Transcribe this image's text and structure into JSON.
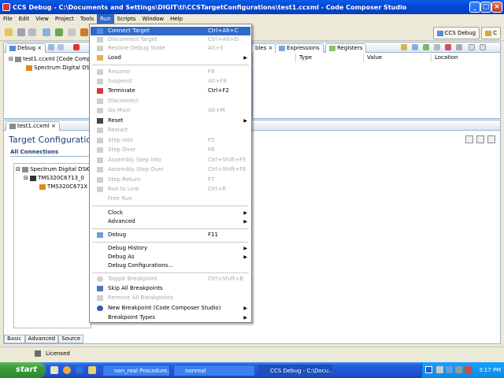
{
  "window": {
    "title": "CCS Debug - C:\\Documents and Settings\\DIGIT\\ti\\CCSTargetConfigurations\\test1.ccxml - Code Composer Studio"
  },
  "menubar": [
    "File",
    "Edit",
    "View",
    "Project",
    "Tools",
    "Run",
    "Scripts",
    "Window",
    "Help"
  ],
  "perspectives": {
    "ccs_debug": "CCS Debug",
    "c_label": "C"
  },
  "debug_view": {
    "tab": "Debug",
    "items": [
      "test1.ccxml [Code Compos",
      "Spectrum Digital DSK-E"
    ]
  },
  "variables_view": {
    "tabs": [
      "bles",
      "Expressions",
      "Registers"
    ],
    "columns": [
      "Type",
      "Value",
      "Location"
    ]
  },
  "editor": {
    "tab": "test1.ccxml",
    "title": "Target Configuration",
    "section": "All Connections",
    "tree": [
      "Spectrum Digital DSK-E",
      "TMS320C6713_0",
      "TMS320C671X"
    ],
    "bottom_tabs": [
      "Basic",
      "Advanced",
      "Source"
    ]
  },
  "status": {
    "licensed": "Licensed"
  },
  "run_menu": {
    "items": [
      {
        "label": "Connect Target",
        "shortcut": "Ctrl+Alt+C",
        "state": "highlighted"
      },
      {
        "label": "Disconnect Target",
        "shortcut": "Ctrl+Alt+D",
        "state": "disabled"
      },
      {
        "label": "Restore Debug State",
        "shortcut": "Alt+E",
        "state": "disabled"
      },
      {
        "label": "Load",
        "shortcut": "",
        "state": "enabled",
        "submenu": true
      },
      {
        "label": "Resume",
        "shortcut": "F8",
        "state": "disabled"
      },
      {
        "label": "Suspend",
        "shortcut": "Alt+F8",
        "state": "disabled"
      },
      {
        "label": "Terminate",
        "shortcut": "Ctrl+F2",
        "state": "enabled"
      },
      {
        "label": "Disconnect",
        "shortcut": "",
        "state": "disabled"
      },
      {
        "label": "Go Main",
        "shortcut": "Alt+M",
        "state": "disabled"
      },
      {
        "label": "Reset",
        "shortcut": "",
        "state": "enabled",
        "submenu": true
      },
      {
        "label": "Restart",
        "shortcut": "",
        "state": "disabled"
      },
      {
        "label": "Step Into",
        "shortcut": "F5",
        "state": "disabled"
      },
      {
        "label": "Step Over",
        "shortcut": "F6",
        "state": "disabled"
      },
      {
        "label": "Assembly Step Into",
        "shortcut": "Ctrl+Shift+F5",
        "state": "disabled"
      },
      {
        "label": "Assembly Step Over",
        "shortcut": "Ctrl+Shift+F6",
        "state": "disabled"
      },
      {
        "label": "Step Return",
        "shortcut": "F7",
        "state": "disabled"
      },
      {
        "label": "Run to Line",
        "shortcut": "Ctrl+R",
        "state": "disabled"
      },
      {
        "label": "Free Run",
        "shortcut": "",
        "state": "disabled"
      },
      {
        "label": "Clock",
        "shortcut": "",
        "state": "enabled",
        "submenu": true
      },
      {
        "label": "Advanced",
        "shortcut": "",
        "state": "enabled",
        "submenu": true
      },
      {
        "label": "Debug",
        "shortcut": "F11",
        "state": "enabled"
      },
      {
        "label": "Debug History",
        "shortcut": "",
        "state": "enabled",
        "submenu": true
      },
      {
        "label": "Debug As",
        "shortcut": "",
        "state": "enabled",
        "submenu": true
      },
      {
        "label": "Debug Configurations...",
        "shortcut": "",
        "state": "enabled"
      },
      {
        "label": "Toggle Breakpoint",
        "shortcut": "Ctrl+Shift+B",
        "state": "disabled"
      },
      {
        "label": "Skip All Breakpoints",
        "shortcut": "",
        "state": "enabled"
      },
      {
        "label": "Remove All Breakpoints",
        "shortcut": "",
        "state": "disabled"
      },
      {
        "label": "New Breakpoint (Code Composer Studio)",
        "shortcut": "",
        "state": "enabled",
        "submenu": true
      },
      {
        "label": "Breakpoint Types",
        "shortcut": "",
        "state": "enabled",
        "submenu": true
      }
    ]
  },
  "taskbar": {
    "start": "start",
    "tasks": [
      "non_real Procedure.d...",
      "nonreal",
      "CCS Debug - C:\\Docu..."
    ],
    "clock": "3:17 PM"
  },
  "colors": {
    "accent": "#316ac5",
    "title": "#0a5de8",
    "start": "#3a9a3a"
  }
}
